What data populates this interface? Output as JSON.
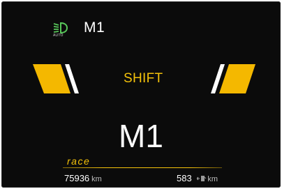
{
  "header": {
    "lamp_label": "AUTO",
    "mode": "M1"
  },
  "shift_indicator": {
    "label": "SHIFT"
  },
  "main": {
    "gear_mode": "M1"
  },
  "footer": {
    "drive_style": "race",
    "odometer_value": "75936",
    "odometer_unit": "km",
    "range_value": "583",
    "range_unit": "km"
  },
  "colors": {
    "accent": "#f4c20a",
    "background": "#0b0b0b",
    "text": "#ffffff",
    "lamp_icon": "#58c85a"
  },
  "icons": {
    "headlamp": "auto-headlight-icon",
    "fuel": "fuel-range-icon"
  }
}
